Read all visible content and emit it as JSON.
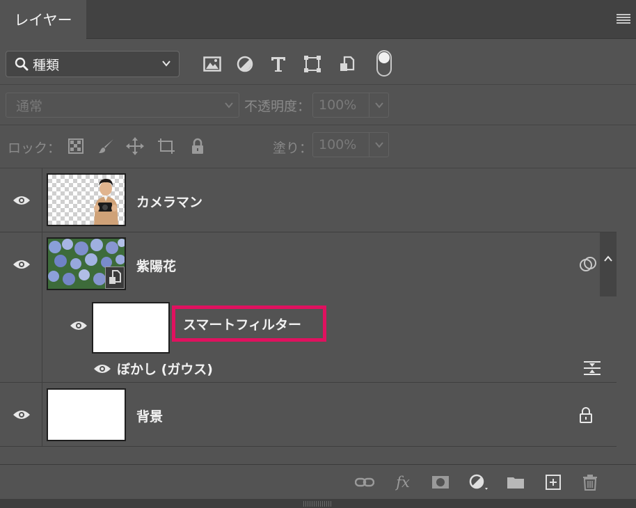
{
  "panel": {
    "tab_label": "レイヤー",
    "menu_icon": "hamburger-menu-icon"
  },
  "filter": {
    "kind_label": "種類",
    "icons": [
      "image-filter-icon",
      "adjustment-filter-icon",
      "type-filter-icon",
      "shape-filter-icon",
      "smart-object-filter-icon"
    ],
    "toggle_on": false
  },
  "blend": {
    "mode": "通常",
    "opacity_label": "不透明度：",
    "opacity_value": "100%"
  },
  "lock": {
    "label": "ロック：",
    "fill_label": "塗り：",
    "fill_value": "100%",
    "icons": [
      "lock-transparent-pixels-icon",
      "lock-image-pixels-icon",
      "lock-position-icon",
      "lock-artboard-icon",
      "lock-all-icon"
    ]
  },
  "layers": [
    {
      "name": "カメラマン",
      "visible": true,
      "thumbnail": "person-with-camera-on-transparent"
    },
    {
      "name": "紫陽花",
      "visible": true,
      "thumbnail": "hydrangea-photo",
      "smart_object": true,
      "smart_filters": {
        "label": "スマートフィルター",
        "visible": true,
        "filters": [
          {
            "name": "ぼかし (ガウス)",
            "visible": true
          }
        ]
      }
    },
    {
      "name": "背景",
      "visible": true,
      "thumbnail": "white",
      "locked": true
    }
  ],
  "bottom_toolbar": {
    "fx_label": "fx",
    "icons": [
      "link-layers-icon",
      "layer-style-icon",
      "add-mask-icon",
      "adjustment-layer-icon",
      "group-folder-icon",
      "new-layer-icon",
      "delete-layer-icon"
    ]
  },
  "colors": {
    "panel_bg": "#535353",
    "highlight_border": "#e0115f"
  }
}
